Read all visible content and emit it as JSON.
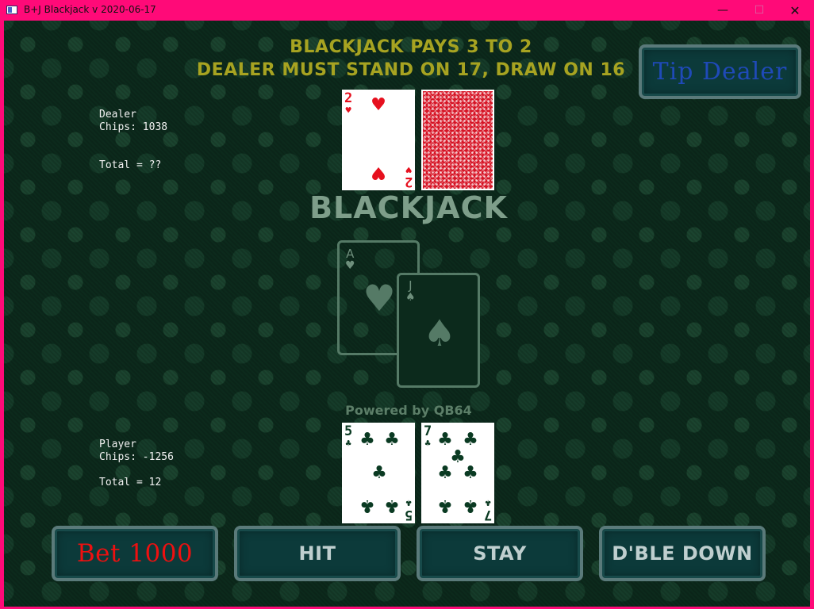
{
  "window": {
    "title": "B+J Blackjack v 2020-06-17",
    "minimize": "—",
    "maximize": "☐",
    "close": "✕"
  },
  "rules": {
    "line1": "BLACKJACK PAYS 3 TO 2",
    "line2": "DEALER MUST STAND ON 17, DRAW ON 16"
  },
  "tip_button": "Tip Dealer",
  "dealer": {
    "name": "Dealer",
    "chips_label": "Chips:",
    "chips": "1038",
    "total_label": "Total =",
    "total": "??",
    "cards": [
      {
        "rank": "2",
        "suit": "♥",
        "color": "#e6101e",
        "face_up": true
      },
      {
        "face_up": false
      }
    ]
  },
  "player": {
    "name": "Player",
    "chips_label": "Chips:",
    "chips": "-1256",
    "total_label": "Total =",
    "total": "12",
    "cards": [
      {
        "rank": "5",
        "suit": "♣",
        "color": "#0a3a22",
        "face_up": true
      },
      {
        "rank": "7",
        "suit": "♣",
        "color": "#0a3a22",
        "face_up": true
      }
    ]
  },
  "logo": {
    "title": "BLACKJACK",
    "ace": "A",
    "jack": "J",
    "ace_suit": "♥",
    "jack_suit": "♠"
  },
  "powered_by": "Powered by QB64",
  "actions": {
    "bet": "Bet 1000",
    "hit": "HIT",
    "stay": "STAY",
    "double": "D'BLE DOWN"
  },
  "colors": {
    "title_bar": "#ff0a78",
    "felt": "#0c2a1c",
    "rules_text": "#a7a321",
    "button_fill": "#0c3a3a",
    "button_border": "#5a7a7a",
    "bet_text": "#ee1010",
    "tip_text": "#1f4ab8"
  }
}
